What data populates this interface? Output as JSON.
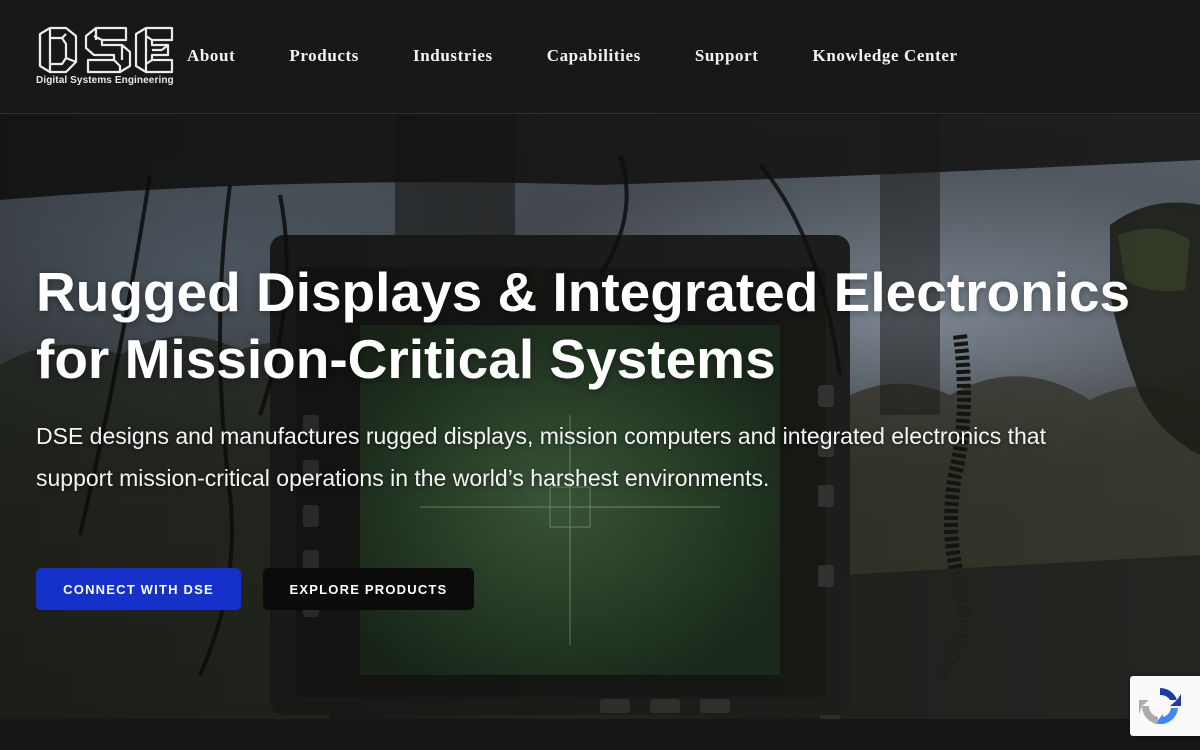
{
  "brand": {
    "logo_letters": "DSE",
    "name": "Digital Systems Engineering"
  },
  "nav": {
    "items": [
      {
        "label": "About"
      },
      {
        "label": "Products"
      },
      {
        "label": "Industries"
      },
      {
        "label": "Capabilities"
      },
      {
        "label": "Support"
      },
      {
        "label": "Knowledge Center"
      }
    ]
  },
  "hero": {
    "title": "Rugged Displays & Integrated Electronics for Mission-Critical Systems",
    "description": "DSE designs and manufactures rugged displays, mission computers and integrated electronics that support mission-critical operations in the world’s harshest environments.",
    "primary_cta": "CONNECT WITH DSE",
    "secondary_cta": "EXPLORE PRODUCTS"
  },
  "colors": {
    "header_bg": "#18181b",
    "primary_button": "#1631c9",
    "secondary_button": "#0b0b0c",
    "text": "#ffffff"
  },
  "icons": {
    "recaptcha": "recaptcha-icon"
  }
}
